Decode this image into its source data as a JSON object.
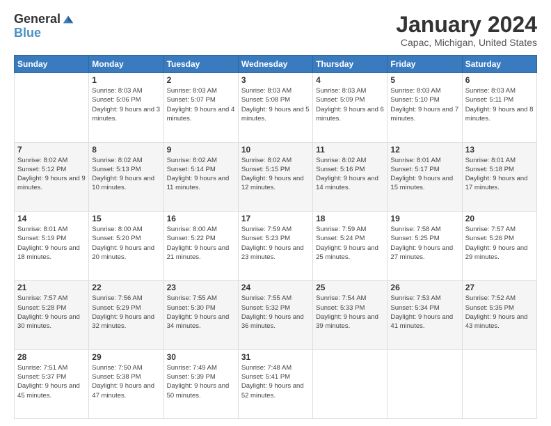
{
  "header": {
    "logo_line1": "General",
    "logo_line2": "Blue",
    "month": "January 2024",
    "location": "Capac, Michigan, United States"
  },
  "weekdays": [
    "Sunday",
    "Monday",
    "Tuesday",
    "Wednesday",
    "Thursday",
    "Friday",
    "Saturday"
  ],
  "weeks": [
    [
      {
        "day": "",
        "sunrise": "",
        "sunset": "",
        "daylight": ""
      },
      {
        "day": "1",
        "sunrise": "Sunrise: 8:03 AM",
        "sunset": "Sunset: 5:06 PM",
        "daylight": "Daylight: 9 hours and 3 minutes."
      },
      {
        "day": "2",
        "sunrise": "Sunrise: 8:03 AM",
        "sunset": "Sunset: 5:07 PM",
        "daylight": "Daylight: 9 hours and 4 minutes."
      },
      {
        "day": "3",
        "sunrise": "Sunrise: 8:03 AM",
        "sunset": "Sunset: 5:08 PM",
        "daylight": "Daylight: 9 hours and 5 minutes."
      },
      {
        "day": "4",
        "sunrise": "Sunrise: 8:03 AM",
        "sunset": "Sunset: 5:09 PM",
        "daylight": "Daylight: 9 hours and 6 minutes."
      },
      {
        "day": "5",
        "sunrise": "Sunrise: 8:03 AM",
        "sunset": "Sunset: 5:10 PM",
        "daylight": "Daylight: 9 hours and 7 minutes."
      },
      {
        "day": "6",
        "sunrise": "Sunrise: 8:03 AM",
        "sunset": "Sunset: 5:11 PM",
        "daylight": "Daylight: 9 hours and 8 minutes."
      }
    ],
    [
      {
        "day": "7",
        "sunrise": "Sunrise: 8:02 AM",
        "sunset": "Sunset: 5:12 PM",
        "daylight": "Daylight: 9 hours and 9 minutes."
      },
      {
        "day": "8",
        "sunrise": "Sunrise: 8:02 AM",
        "sunset": "Sunset: 5:13 PM",
        "daylight": "Daylight: 9 hours and 10 minutes."
      },
      {
        "day": "9",
        "sunrise": "Sunrise: 8:02 AM",
        "sunset": "Sunset: 5:14 PM",
        "daylight": "Daylight: 9 hours and 11 minutes."
      },
      {
        "day": "10",
        "sunrise": "Sunrise: 8:02 AM",
        "sunset": "Sunset: 5:15 PM",
        "daylight": "Daylight: 9 hours and 12 minutes."
      },
      {
        "day": "11",
        "sunrise": "Sunrise: 8:02 AM",
        "sunset": "Sunset: 5:16 PM",
        "daylight": "Daylight: 9 hours and 14 minutes."
      },
      {
        "day": "12",
        "sunrise": "Sunrise: 8:01 AM",
        "sunset": "Sunset: 5:17 PM",
        "daylight": "Daylight: 9 hours and 15 minutes."
      },
      {
        "day": "13",
        "sunrise": "Sunrise: 8:01 AM",
        "sunset": "Sunset: 5:18 PM",
        "daylight": "Daylight: 9 hours and 17 minutes."
      }
    ],
    [
      {
        "day": "14",
        "sunrise": "Sunrise: 8:01 AM",
        "sunset": "Sunset: 5:19 PM",
        "daylight": "Daylight: 9 hours and 18 minutes."
      },
      {
        "day": "15",
        "sunrise": "Sunrise: 8:00 AM",
        "sunset": "Sunset: 5:20 PM",
        "daylight": "Daylight: 9 hours and 20 minutes."
      },
      {
        "day": "16",
        "sunrise": "Sunrise: 8:00 AM",
        "sunset": "Sunset: 5:22 PM",
        "daylight": "Daylight: 9 hours and 21 minutes."
      },
      {
        "day": "17",
        "sunrise": "Sunrise: 7:59 AM",
        "sunset": "Sunset: 5:23 PM",
        "daylight": "Daylight: 9 hours and 23 minutes."
      },
      {
        "day": "18",
        "sunrise": "Sunrise: 7:59 AM",
        "sunset": "Sunset: 5:24 PM",
        "daylight": "Daylight: 9 hours and 25 minutes."
      },
      {
        "day": "19",
        "sunrise": "Sunrise: 7:58 AM",
        "sunset": "Sunset: 5:25 PM",
        "daylight": "Daylight: 9 hours and 27 minutes."
      },
      {
        "day": "20",
        "sunrise": "Sunrise: 7:57 AM",
        "sunset": "Sunset: 5:26 PM",
        "daylight": "Daylight: 9 hours and 29 minutes."
      }
    ],
    [
      {
        "day": "21",
        "sunrise": "Sunrise: 7:57 AM",
        "sunset": "Sunset: 5:28 PM",
        "daylight": "Daylight: 9 hours and 30 minutes."
      },
      {
        "day": "22",
        "sunrise": "Sunrise: 7:56 AM",
        "sunset": "Sunset: 5:29 PM",
        "daylight": "Daylight: 9 hours and 32 minutes."
      },
      {
        "day": "23",
        "sunrise": "Sunrise: 7:55 AM",
        "sunset": "Sunset: 5:30 PM",
        "daylight": "Daylight: 9 hours and 34 minutes."
      },
      {
        "day": "24",
        "sunrise": "Sunrise: 7:55 AM",
        "sunset": "Sunset: 5:32 PM",
        "daylight": "Daylight: 9 hours and 36 minutes."
      },
      {
        "day": "25",
        "sunrise": "Sunrise: 7:54 AM",
        "sunset": "Sunset: 5:33 PM",
        "daylight": "Daylight: 9 hours and 39 minutes."
      },
      {
        "day": "26",
        "sunrise": "Sunrise: 7:53 AM",
        "sunset": "Sunset: 5:34 PM",
        "daylight": "Daylight: 9 hours and 41 minutes."
      },
      {
        "day": "27",
        "sunrise": "Sunrise: 7:52 AM",
        "sunset": "Sunset: 5:35 PM",
        "daylight": "Daylight: 9 hours and 43 minutes."
      }
    ],
    [
      {
        "day": "28",
        "sunrise": "Sunrise: 7:51 AM",
        "sunset": "Sunset: 5:37 PM",
        "daylight": "Daylight: 9 hours and 45 minutes."
      },
      {
        "day": "29",
        "sunrise": "Sunrise: 7:50 AM",
        "sunset": "Sunset: 5:38 PM",
        "daylight": "Daylight: 9 hours and 47 minutes."
      },
      {
        "day": "30",
        "sunrise": "Sunrise: 7:49 AM",
        "sunset": "Sunset: 5:39 PM",
        "daylight": "Daylight: 9 hours and 50 minutes."
      },
      {
        "day": "31",
        "sunrise": "Sunrise: 7:48 AM",
        "sunset": "Sunset: 5:41 PM",
        "daylight": "Daylight: 9 hours and 52 minutes."
      },
      {
        "day": "",
        "sunrise": "",
        "sunset": "",
        "daylight": ""
      },
      {
        "day": "",
        "sunrise": "",
        "sunset": "",
        "daylight": ""
      },
      {
        "day": "",
        "sunrise": "",
        "sunset": "",
        "daylight": ""
      }
    ]
  ]
}
